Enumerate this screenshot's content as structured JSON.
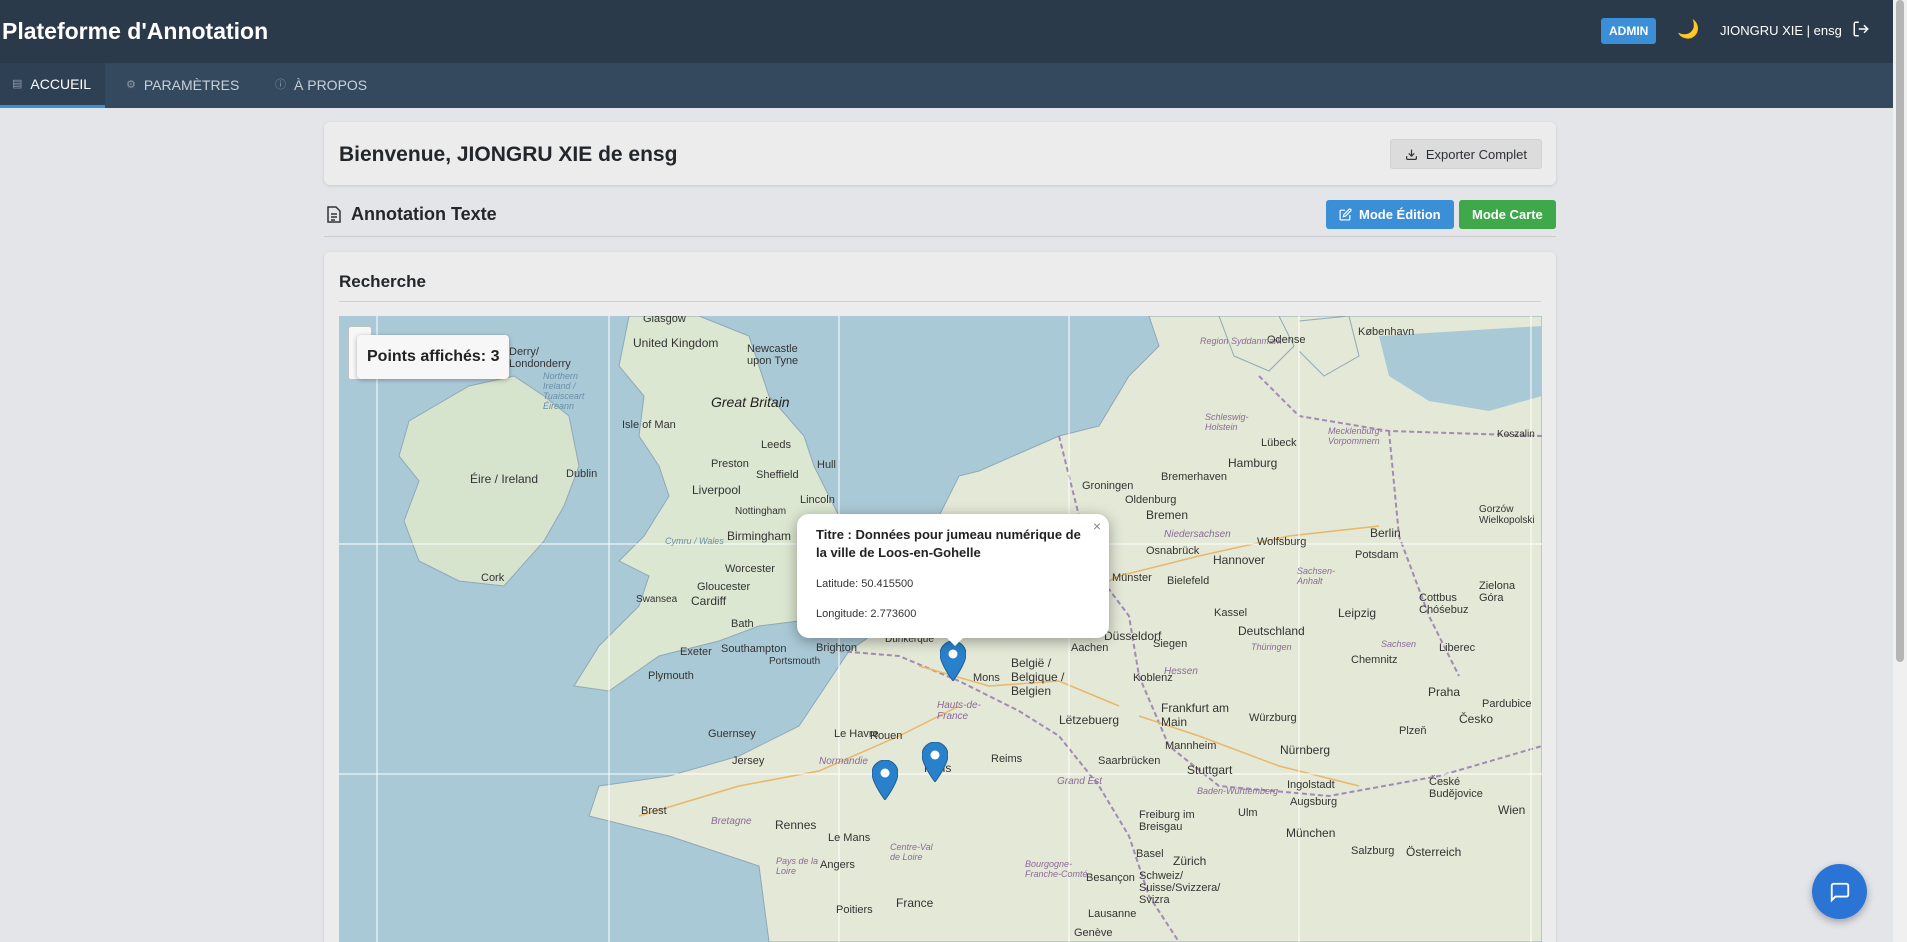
{
  "header": {
    "app_title": "Plateforme d'Annotation",
    "admin_badge": "ADMIN",
    "theme_icon": "moon-icon",
    "user": "JIONGRU XIE | ensg",
    "logout_icon": "logout-icon"
  },
  "tabs": [
    {
      "label": "ACCUEIL",
      "icon": "home-icon",
      "active": true
    },
    {
      "label": "PARAMÈTRES",
      "icon": "gear-icon",
      "active": false
    },
    {
      "label": "À PROPOS",
      "icon": "info-icon",
      "active": false
    }
  ],
  "welcome": {
    "text": "Bienvenue, JIONGRU XIE de ensg",
    "export_label": "Exporter Complet"
  },
  "section": {
    "title": "Annotation Texte",
    "mode_edit": "Mode Édition",
    "mode_carte": "Mode Carte"
  },
  "search": {
    "title": "Recherche"
  },
  "map": {
    "points_label": "Points affichés: 3",
    "popup": {
      "title": "Titre : Données pour jumeau numérique de la ville de Loos-en-Gohelle",
      "latitude": "Latitude: 50.415500",
      "longitude": "Longitude: 2.773600"
    },
    "labels": {
      "glasgow": "Glasgow",
      "uk": "United Kingdom",
      "newcastle": "Newcastle upon Tyne",
      "great_britain": "Great Britain",
      "isle_of_man": "Isle of Man",
      "derry": "Derry/ Londonderry",
      "northern_ireland": "Northern Ireland / Tuaisceart Éireann",
      "dublin": "Dublin",
      "eire": "Éire / Ireland",
      "cork": "Cork",
      "leeds": "Leeds",
      "preston": "Preston",
      "liverpool": "Liverpool",
      "sheffield": "Sheffield",
      "hull": "Hull",
      "lincoln": "Lincoln",
      "nottingham": "Nottingham",
      "birmingham": "Birmingham",
      "wales": "Cymru / Wales",
      "worcester": "Worcester",
      "gloucester": "Gloucester",
      "swansea": "Swansea",
      "cardiff": "Cardiff",
      "bath": "Bath",
      "exeter": "Exeter",
      "southampton": "Southampton",
      "portsmouth": "Portsmouth",
      "brighton": "Brighton",
      "plymouth": "Plymouth",
      "dunkerque": "Dunkerque",
      "guernsey": "Guernsey",
      "jersey": "Jersey",
      "le_havre": "Le Havre",
      "rouen": "Rouen",
      "normandie": "Normandie",
      "paris": "Paris",
      "reims": "Reims",
      "hauts_de_france": "Hauts-de-France",
      "mons": "Mons",
      "belgique": "België / Belgique / Belgien",
      "brest": "Brest",
      "bretagne": "Bretagne",
      "rennes": "Rennes",
      "le_mans": "Le Mans",
      "pays_de_la_loire": "Pays de la Loire",
      "angers": "Angers",
      "centre": "Centre-Val de Loire",
      "france": "France",
      "poitiers": "Poitiers",
      "bourgogne": "Bourgogne-Franche-Comté",
      "grand_est": "Grand Est",
      "besancon": "Besançon",
      "lausanne": "Lausanne",
      "geneve": "Genève",
      "letzebuerg": "Lëtzebuerg",
      "saarbrucken": "Saarbrücken",
      "mannheim": "Mannheim",
      "frankfurt": "Frankfurt am Main",
      "koblenz": "Koblenz",
      "hessen": "Hessen",
      "siegen": "Siegen",
      "aachen": "Aachen",
      "dusseldorf": "Düsseldorf",
      "munster": "Münster",
      "bielefeld": "Bielefeld",
      "kassel": "Kassel",
      "hannover": "Hannover",
      "osnabruck": "Osnabrück",
      "bremen": "Bremen",
      "niedersachsen": "Niedersachsen",
      "groningen": "Groningen",
      "oldenburg": "Oldenburg",
      "bremerhaven": "Bremerhaven",
      "hamburg": "Hamburg",
      "lubeck": "Lübeck",
      "schleswig": "Schleswig-Holstein",
      "mecklenburg": "Mecklenburg-Vorpommern",
      "kobenhavn": "København",
      "odense": "Odense",
      "syddanmark": "Region Syddanmark",
      "berlin": "Berlin",
      "potsdam": "Potsdam",
      "wolfsburg": "Wolfsburg",
      "sachsen_anhalt": "Sachsen-Anhalt",
      "leipzig": "Leipzig",
      "deutschland": "Deutschland",
      "thuringen": "Thüringen",
      "chemnitz": "Chemnitz",
      "sachsen": "Sachsen",
      "cottbus": "Cottbus Chóśebuz",
      "zielona": "Zielona Góra",
      "liberec": "Liberec",
      "praha": "Praha",
      "pardubice": "Pardubice",
      "cesko": "Česko",
      "plzen": "Plzeň",
      "nurnberg": "Nürnberg",
      "wurzburg": "Würzburg",
      "stuttgart": "Stuttgart",
      "bw": "Baden-Württemberg",
      "ingolstadt": "Ingolstadt",
      "augsburg": "Augsburg",
      "ulm": "Ulm",
      "munchen": "München",
      "freiburg": "Freiburg im Breisgau",
      "basel": "Basel",
      "zurich": "Zürich",
      "schweiz": "Schweiz/ Suisse/Svizzera/ Svizra",
      "salzburg": "Salzburg",
      "osterreich": "Österreich",
      "wien": "Wien",
      "ceske": "České Budějovice",
      "koszalin": "Koszalin",
      "gorzow": "Gorzów Wielkopolski"
    }
  }
}
